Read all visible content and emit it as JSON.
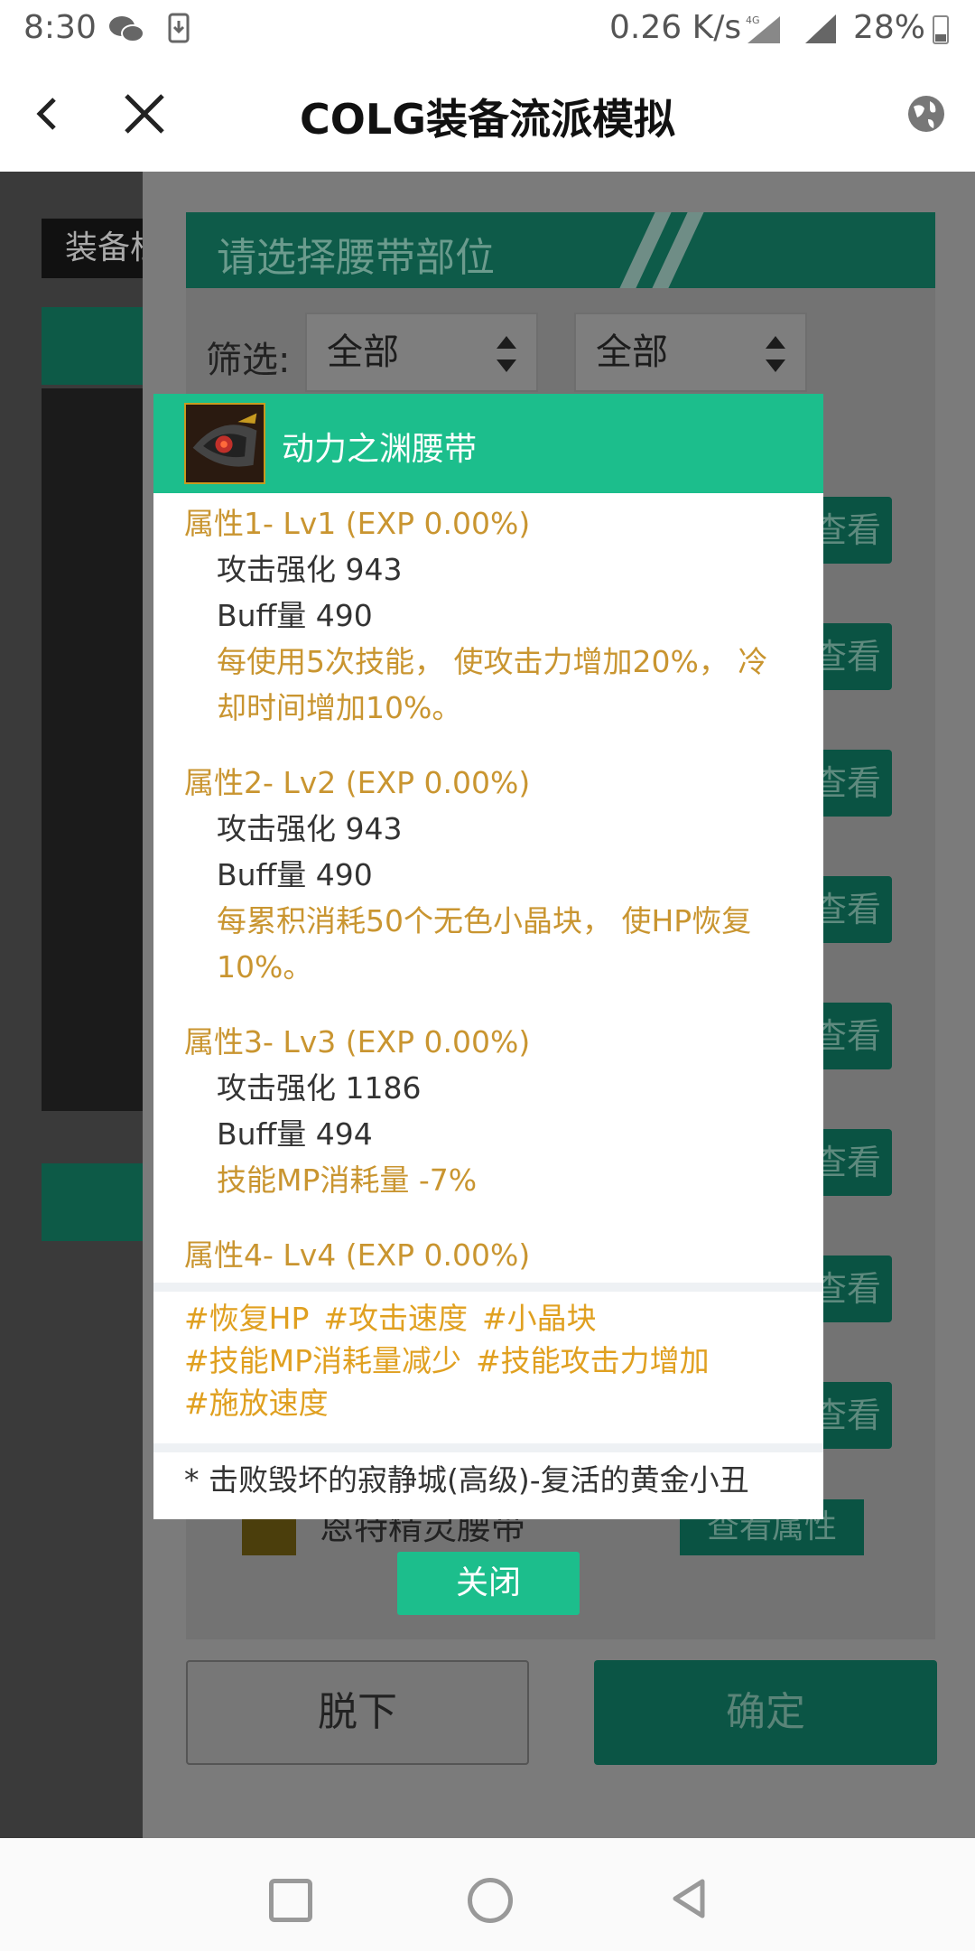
{
  "status_bar": {
    "time": "8:30",
    "network_speed": "0.26 K/s",
    "battery": "28%"
  },
  "title_bar": {
    "title": "COLG装备流派模拟"
  },
  "background": {
    "side_tab_label": "装备栏",
    "section_header": "请选择腰带部位",
    "filter_label": "筛选:",
    "filter1_value": "全部",
    "filter2_value": "全部",
    "list_button_label": "查看属性",
    "last_item_name": "恩特精灵腰带",
    "unequip_button": "脱下",
    "confirm_button": "确定"
  },
  "modal": {
    "item_name": "动力之渊腰带",
    "attributes": [
      {
        "header": "属性1- Lv1 (EXP 0.00%)",
        "stat1": "攻击强化 943",
        "stat2": "Buff量 490",
        "effect_line1": "每使用5次技能， 使攻击力增加20%， 冷",
        "effect_line2": "却时间增加10%。"
      },
      {
        "header": "属性2- Lv2 (EXP 0.00%)",
        "stat1": "攻击强化 943",
        "stat2": "Buff量 490",
        "effect_line1": "每累积消耗50个无色小晶块， 使HP恢复",
        "effect_line2": "10%。"
      },
      {
        "header": "属性3- Lv3 (EXP 0.00%)",
        "stat1": "攻击强化 1186",
        "stat2": "Buff量 494",
        "effect_line1": "技能MP消耗量 -7%"
      },
      {
        "header": "属性4- Lv4 (EXP 0.00%)"
      }
    ],
    "tags": [
      "#恢复HP",
      "#攻击速度",
      "#小晶块",
      "#技能MP消耗量减少",
      "#技能攻击力增加",
      "#施放速度"
    ],
    "source": "* 击败毁坏的寂静城(高级)-复活的黄金小丑",
    "close_button": "关闭"
  }
}
